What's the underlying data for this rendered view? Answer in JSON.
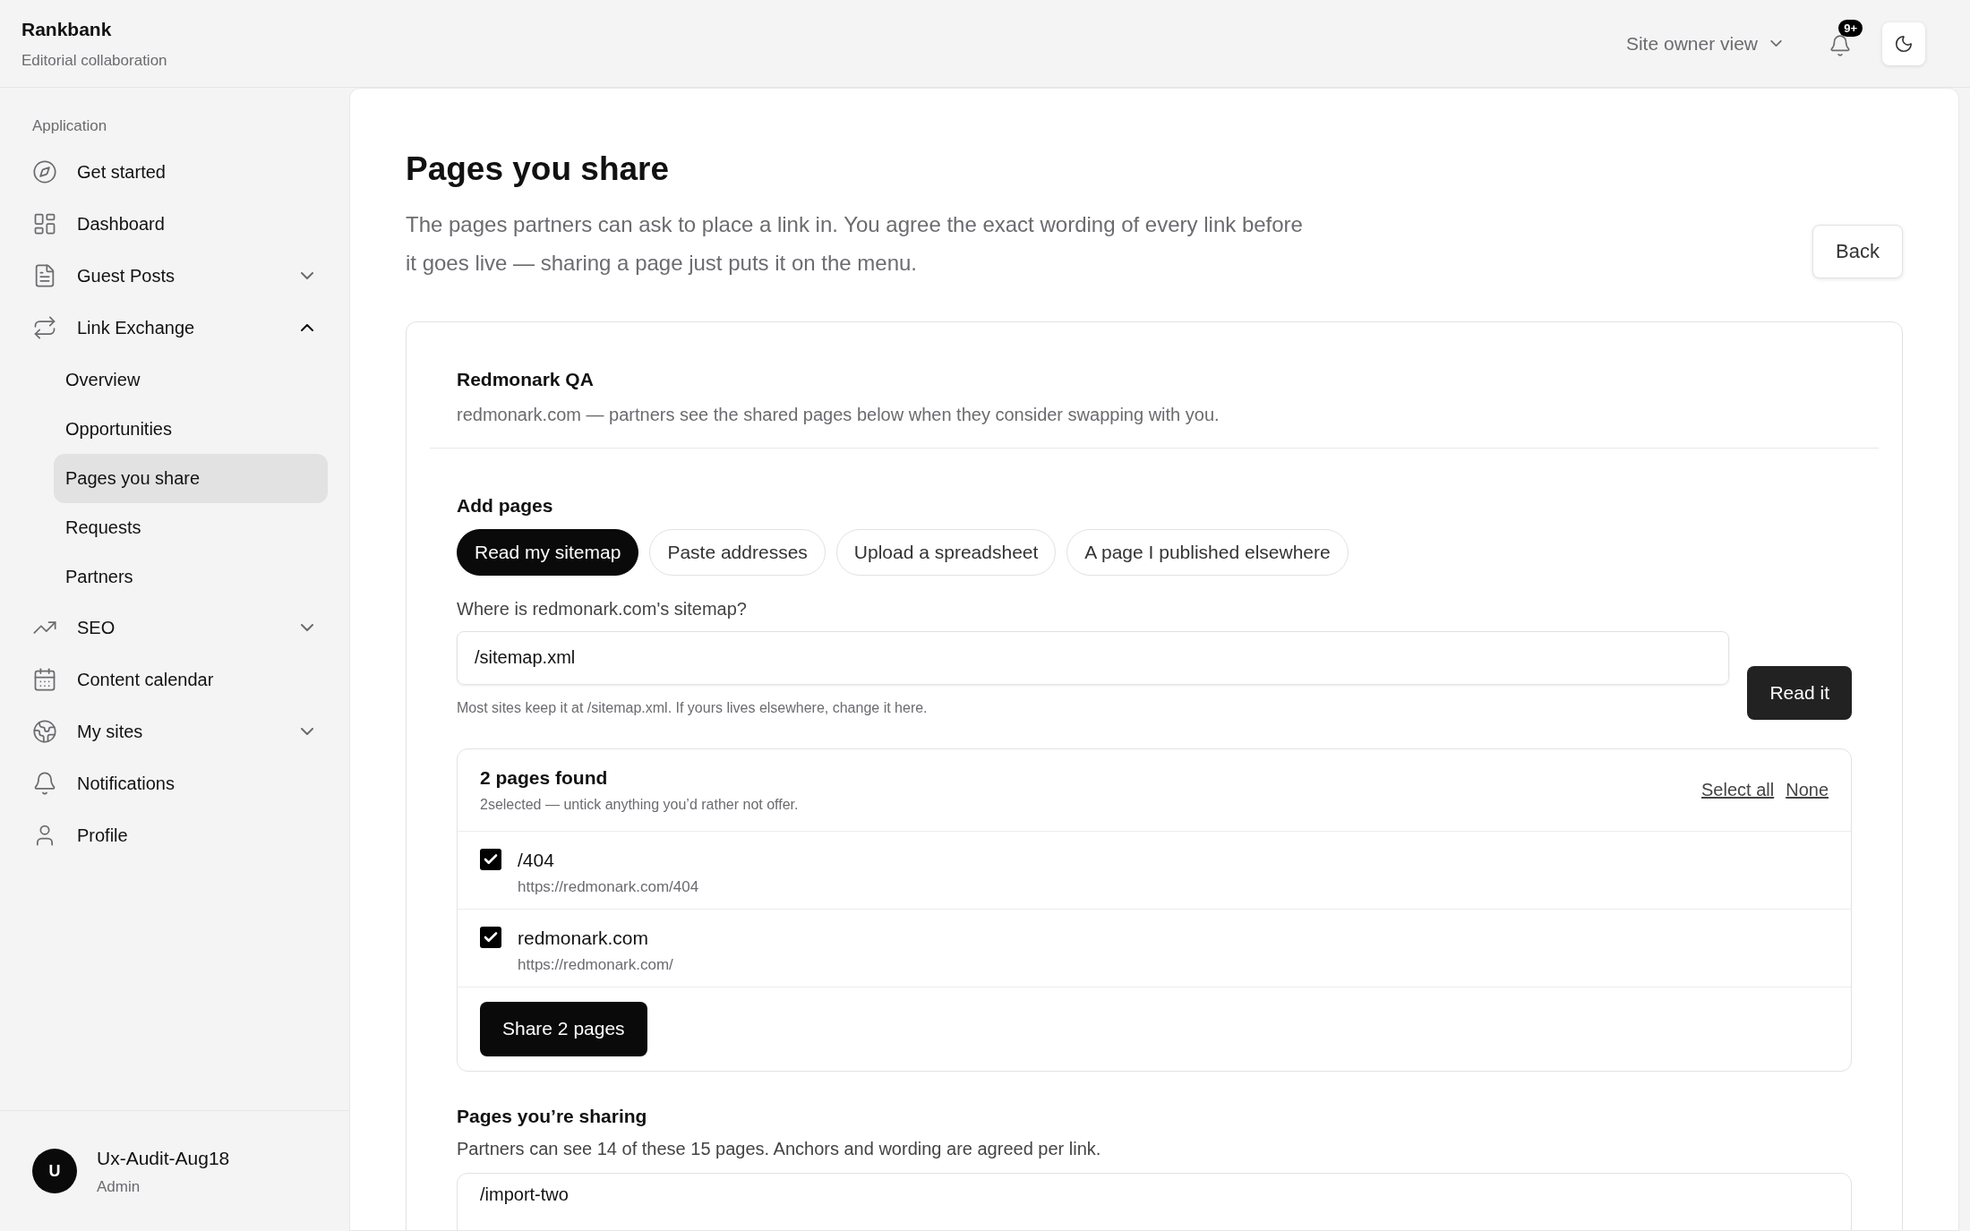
{
  "brand": {
    "name": "Rankbank",
    "tagline": "Editorial collaboration"
  },
  "header": {
    "view_switch": "Site owner view",
    "notification_badge": "9+"
  },
  "sidebar": {
    "section": "Application",
    "items": [
      {
        "label": "Get started",
        "selected": false
      },
      {
        "label": "Dashboard",
        "selected": false
      },
      {
        "label": "Guest Posts",
        "selected": false,
        "expanded": false
      },
      {
        "label": "Link Exchange",
        "selected": false,
        "expanded": true,
        "children": [
          {
            "label": "Overview",
            "selected": false
          },
          {
            "label": "Opportunities",
            "selected": false
          },
          {
            "label": "Pages you share",
            "selected": true
          },
          {
            "label": "Requests",
            "selected": false
          },
          {
            "label": "Partners",
            "selected": false
          }
        ]
      },
      {
        "label": "SEO",
        "selected": false,
        "expanded": false
      },
      {
        "label": "Content calendar",
        "selected": false
      },
      {
        "label": "My sites",
        "selected": false,
        "expanded": false
      },
      {
        "label": "Notifications",
        "selected": false
      },
      {
        "label": "Profile",
        "selected": false
      }
    ],
    "user": {
      "initial": "U",
      "name": "Ux-Audit-Aug18",
      "role": "Admin"
    }
  },
  "page": {
    "title": "Pages you share",
    "description": "The pages partners can ask to place a link in. You agree the exact wording of every link before it goes live — sharing a page just puts it on the menu.",
    "back_button": "Back"
  },
  "site_card": {
    "name": "Redmonark QA",
    "description": "redmonark.com — partners see the shared pages below when they consider swapping with you.",
    "add_pages": {
      "heading": "Add pages",
      "tabs": [
        {
          "label": "Read my sitemap",
          "selected": true
        },
        {
          "label": "Paste addresses",
          "selected": false
        },
        {
          "label": "Upload a spreadsheet",
          "selected": false
        },
        {
          "label": "A page I published elsewhere",
          "selected": false
        }
      ],
      "field_label": "Where is redmonark.com's sitemap?",
      "field_value": "/sitemap.xml",
      "submit_button": "Read it",
      "hint": "Most sites keep it at /sitemap.xml. If yours lives elsewhere, change it here."
    },
    "found": {
      "title": "2 pages found",
      "subtitle": "2selected — untick anything you’d rather not offer.",
      "select_all": "Select all",
      "select_none": "None",
      "pages": [
        {
          "title": "/404",
          "url": "https://redmonark.com/404",
          "checked": true
        },
        {
          "title": "redmonark.com",
          "url": "https://redmonark.com/",
          "checked": true
        }
      ],
      "share_button": "Share 2 pages"
    },
    "sharing": {
      "heading": "Pages you’re sharing",
      "description": "Partners can see 14 of these 15 pages. Anchors and wording are agreed per link.",
      "first_page": "/import-two"
    }
  }
}
